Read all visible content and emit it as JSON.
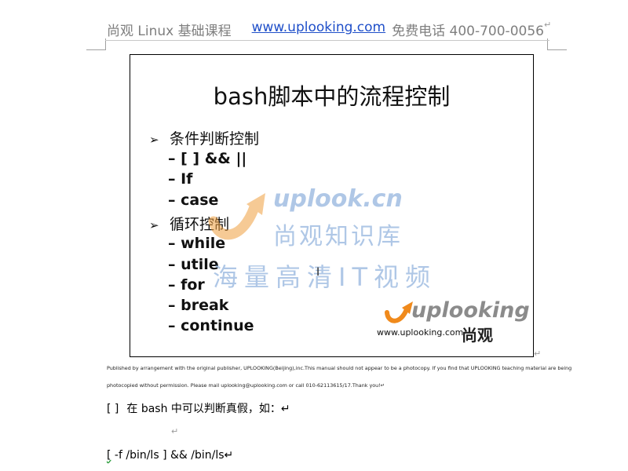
{
  "header": {
    "course": "尚观 Linux 基础课程",
    "url": "www.uplooking.com",
    "phone": "免费电话 400-700-0056",
    "mark": "↵"
  },
  "slide": {
    "title": "bash脚本中的流程控制",
    "bullet": "➢",
    "sections": [
      {
        "label": "条件判断控制",
        "items": [
          "– [ ]   &&   ||",
          "– If",
          "– case"
        ]
      },
      {
        "label": "循环控制",
        "items": [
          "– while",
          "– utile",
          "– for",
          "– break",
          "– continue"
        ]
      }
    ],
    "watermark": {
      "site": "uplook.cn",
      "name": "尚观知识库",
      "slogan": "海量高清IT视频"
    },
    "logo": {
      "word": "uplooking",
      "url": "www.uplooking.com",
      "cn": "尚观"
    },
    "end_mark": "↵"
  },
  "body": {
    "notice_line1": "Published by arrangement with the original publisher, UPLOOKING(Beijing),inc.This manual should not appear to be a photocopy. If you find that UPLOOKING teaching material are being",
    "notice_line2": "photocopied without permission. Please mail uplooking@uplooking.com or call 010-62113615/17.Thank you!↵",
    "bracket": "[   ]",
    "line1_text": "在 bash 中可以判断真假，如：↵",
    "empty_mark": "↵",
    "line2_open": "[",
    "line2_rest": "  -f   /bin/ls   ]     &&   /bin/ls↵"
  }
}
